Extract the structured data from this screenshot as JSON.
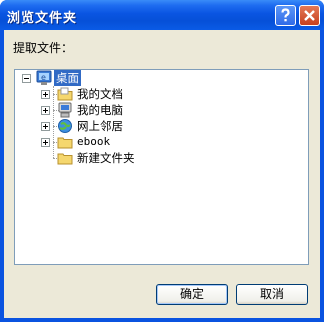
{
  "window": {
    "title": "浏览文件夹"
  },
  "titlebar_buttons": {
    "help_icon": "question-mark",
    "close_icon": "x"
  },
  "prompt_label": "提取文件：",
  "tree": {
    "root": {
      "label": "桌面",
      "icon": "desktop-icon",
      "expanded": true,
      "selected": true
    },
    "items": [
      {
        "label": "我的文档",
        "icon": "my-documents-folder-icon",
        "expandable": true
      },
      {
        "label": "我的电脑",
        "icon": "my-computer-icon",
        "expandable": true
      },
      {
        "label": "网上邻居",
        "icon": "network-places-icon",
        "expandable": true
      },
      {
        "label": "ebook",
        "icon": "folder-icon",
        "expandable": true
      },
      {
        "label": "新建文件夹",
        "icon": "folder-icon",
        "expandable": false
      }
    ]
  },
  "buttons": {
    "ok": "确定",
    "cancel": "取消"
  },
  "colors": {
    "titlebar": "#0A55E2",
    "dialog_bg": "#ECE9D8",
    "selection": "#316AC5"
  }
}
